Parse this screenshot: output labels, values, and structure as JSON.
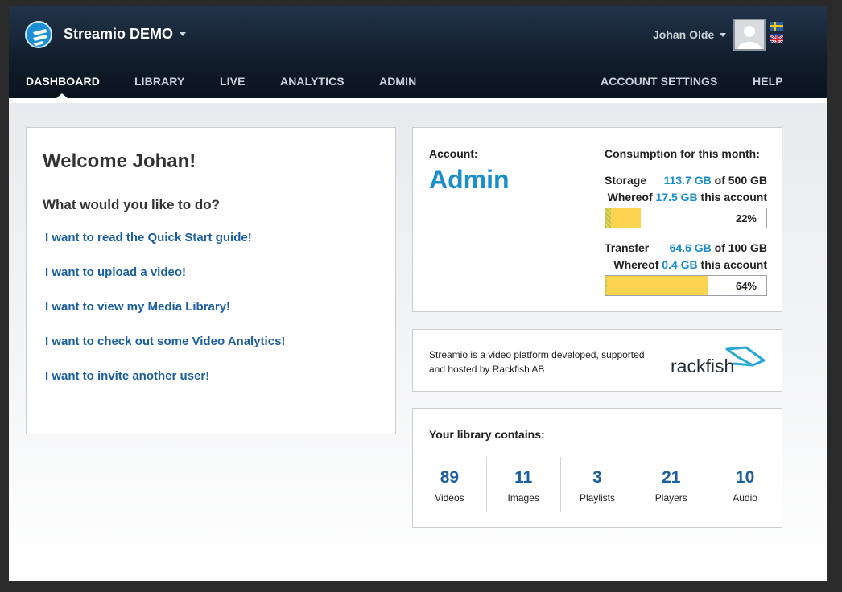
{
  "header": {
    "app_title": "Streamio DEMO",
    "user_name": "Johan Olde",
    "flags": [
      "sweden-flag",
      "uk-flag"
    ]
  },
  "nav": {
    "left": [
      "DASHBOARD",
      "LIBRARY",
      "LIVE",
      "ANALYTICS",
      "ADMIN"
    ],
    "right": [
      "ACCOUNT SETTINGS",
      "HELP"
    ],
    "active": "DASHBOARD"
  },
  "welcome": {
    "title": "Welcome Johan!",
    "question": "What would you like to do?",
    "links": [
      "I want to read the Quick Start guide!",
      "I want to upload a video!",
      "I want to view my Media Library!",
      "I want to check out some Video Analytics!",
      "I want to invite another user!"
    ]
  },
  "account": {
    "label": "Account:",
    "role": "Admin",
    "consumption_title": "Consumption for this month:",
    "storage": {
      "label": "Storage",
      "used": "113.7 GB",
      "of_total": "of 500 GB",
      "whereof_label": "Whereof",
      "whereof_value": "17.5 GB",
      "whereof_suffix": "this account",
      "percent_text": "22%",
      "total_fraction": 0.22,
      "account_fraction": 0.035
    },
    "transfer": {
      "label": "Transfer",
      "used": "64.6 GB",
      "of_total": "of 100 GB",
      "whereof_label": "Whereof",
      "whereof_value": "0.4 GB",
      "whereof_suffix": "this account",
      "percent_text": "64%",
      "total_fraction": 0.64,
      "account_fraction": 0.004
    }
  },
  "about": {
    "text": "Streamio is a video platform developed, supported and hosted by Rackfish AB",
    "logo_text": "rackfish"
  },
  "library": {
    "title": "Your library contains:",
    "stats": [
      {
        "value": "89",
        "label": "Videos"
      },
      {
        "value": "11",
        "label": "Images"
      },
      {
        "value": "3",
        "label": "Playlists"
      },
      {
        "value": "21",
        "label": "Players"
      },
      {
        "value": "10",
        "label": "Audio"
      }
    ]
  },
  "colors": {
    "accent": "#1a8dcc",
    "link": "#1c5f9e",
    "bar_fill": "#fcd450",
    "header_bg": "#101c2a"
  }
}
